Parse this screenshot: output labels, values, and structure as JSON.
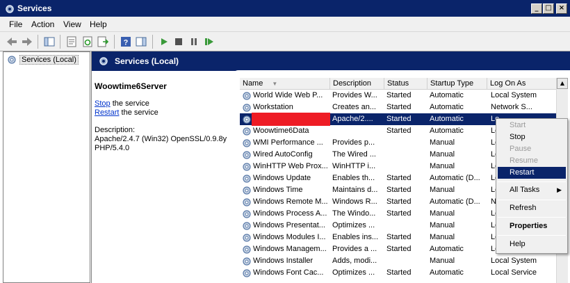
{
  "window": {
    "title": "Services"
  },
  "menubar": {
    "items": [
      "File",
      "Action",
      "View",
      "Help"
    ]
  },
  "toolbar": {
    "icons": [
      "back-icon",
      "forward-icon",
      "show-hide-tree-icon",
      "properties-icon",
      "refresh-icon",
      "export-list-icon",
      "help-icon",
      "show-hide-action-pane-icon",
      "start-service-icon",
      "stop-service-icon",
      "pause-service-icon",
      "restart-service-icon"
    ]
  },
  "tree": {
    "node_label": "Services (Local)"
  },
  "pane_header": {
    "title": "Services (Local)"
  },
  "description": {
    "service_name": "Woowtime6Server",
    "stop_link": "Stop",
    "stop_suffix": " the service",
    "restart_link": "Restart",
    "restart_suffix": " the service",
    "desc_label": "Description:",
    "desc_text_1": "Apache/2.4.7 (Win32) OpenSSL/0.9.8y",
    "desc_text_2": "PHP/5.4.0"
  },
  "columns": {
    "name": "Name",
    "description": "Description",
    "status": "Status",
    "startup_type": "Startup Type",
    "log_on_as": "Log On As"
  },
  "rows": [
    {
      "name": "World Wide Web P...",
      "description": "Provides W...",
      "status": "Started",
      "startup": "Automatic",
      "logon": "Local System"
    },
    {
      "name": "Workstation",
      "description": "Creates an...",
      "status": "Started",
      "startup": "Automatic",
      "logon": "Network S..."
    },
    {
      "name": "",
      "description": "Apache/2....",
      "status": "Started",
      "startup": "Automatic",
      "logon": "Lo"
    },
    {
      "name": "Woowtime6Data",
      "description": "",
      "status": "Started",
      "startup": "Automatic",
      "logon": "Lo"
    },
    {
      "name": "WMI Performance ...",
      "description": "Provides p...",
      "status": "",
      "startup": "Manual",
      "logon": "Lo"
    },
    {
      "name": "Wired AutoConfig",
      "description": "The Wired ...",
      "status": "",
      "startup": "Manual",
      "logon": "Lo"
    },
    {
      "name": "WinHTTP Web Prox...",
      "description": "WinHTTP i...",
      "status": "",
      "startup": "Manual",
      "logon": "Lo"
    },
    {
      "name": "Windows Update",
      "description": "Enables th...",
      "status": "Started",
      "startup": "Automatic (D...",
      "logon": "Lo"
    },
    {
      "name": "Windows Time",
      "description": "Maintains d...",
      "status": "Started",
      "startup": "Manual",
      "logon": "Lo"
    },
    {
      "name": "Windows Remote M...",
      "description": "Windows R...",
      "status": "Started",
      "startup": "Automatic (D...",
      "logon": "N"
    },
    {
      "name": "Windows Process A...",
      "description": "The Windo...",
      "status": "Started",
      "startup": "Manual",
      "logon": "Lo"
    },
    {
      "name": "Windows Presentat...",
      "description": "Optimizes ...",
      "status": "",
      "startup": "Manual",
      "logon": "Lo"
    },
    {
      "name": "Windows Modules I...",
      "description": "Enables ins...",
      "status": "Started",
      "startup": "Manual",
      "logon": "Lo"
    },
    {
      "name": "Windows Managem...",
      "description": "Provides a ...",
      "status": "Started",
      "startup": "Automatic",
      "logon": "Lo"
    },
    {
      "name": "Windows Installer",
      "description": "Adds, modi...",
      "status": "",
      "startup": "Manual",
      "logon": "Local System"
    },
    {
      "name": "Windows Font Cac...",
      "description": "Optimizes ...",
      "status": "Started",
      "startup": "Automatic",
      "logon": "Local Service"
    }
  ],
  "context_menu": {
    "start": "Start",
    "stop": "Stop",
    "pause": "Pause",
    "resume": "Resume",
    "restart": "Restart",
    "all_tasks": "All Tasks",
    "refresh": "Refresh",
    "properties": "Properties",
    "help": "Help"
  },
  "colors": {
    "titlebar": "#0a246a",
    "selection": "#0a246a",
    "redaction": "#ee1c25"
  }
}
